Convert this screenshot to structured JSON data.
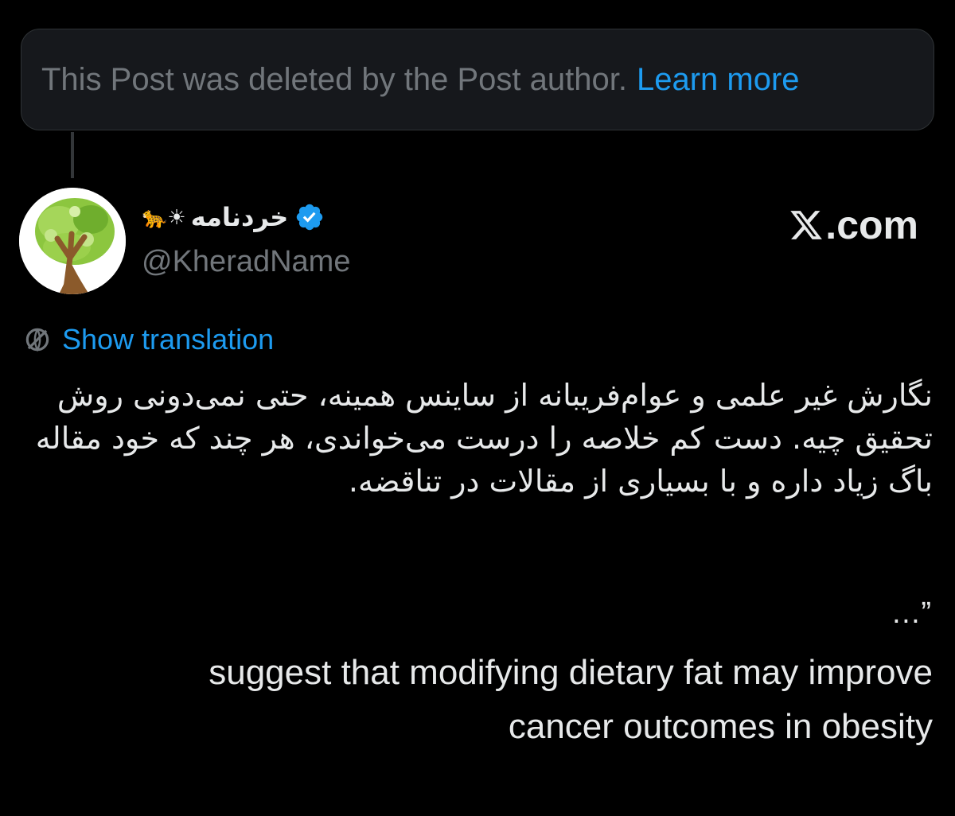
{
  "deleted_notice": {
    "text": "This Post was deleted by the Post author.",
    "link": "Learn more"
  },
  "author": {
    "display_name": "خردنامه",
    "name_emojis": "🐆☀",
    "handle": "@KheradName",
    "verified": true,
    "avatar_icon": "tree-head-avatar"
  },
  "site_mark": {
    "text": ".com",
    "icon": "x-logo-icon"
  },
  "translation": {
    "label": "Show translation",
    "icon": "globe-icon"
  },
  "post": {
    "persian_text": "نگارش غیر علمی و عوام‌فریبانه از ساینس همینه، حتی نمی‌دونی روش تحقیق چیه. دست کم خلاصه را درست می‌خواندی، هر چند که خود مقاله باگ زیاد داره و با بسیاری از مقالات در تناقضه.",
    "ellipsis": "…”",
    "quote_line_1": "suggest that modifying dietary fat may improve",
    "quote_line_2": "cancer outcomes in obesity"
  },
  "colors": {
    "background": "#000000",
    "card": "#16181c",
    "accent": "#1d9bf0",
    "secondary_text": "#71767b",
    "primary_text": "#e7e9ea"
  }
}
